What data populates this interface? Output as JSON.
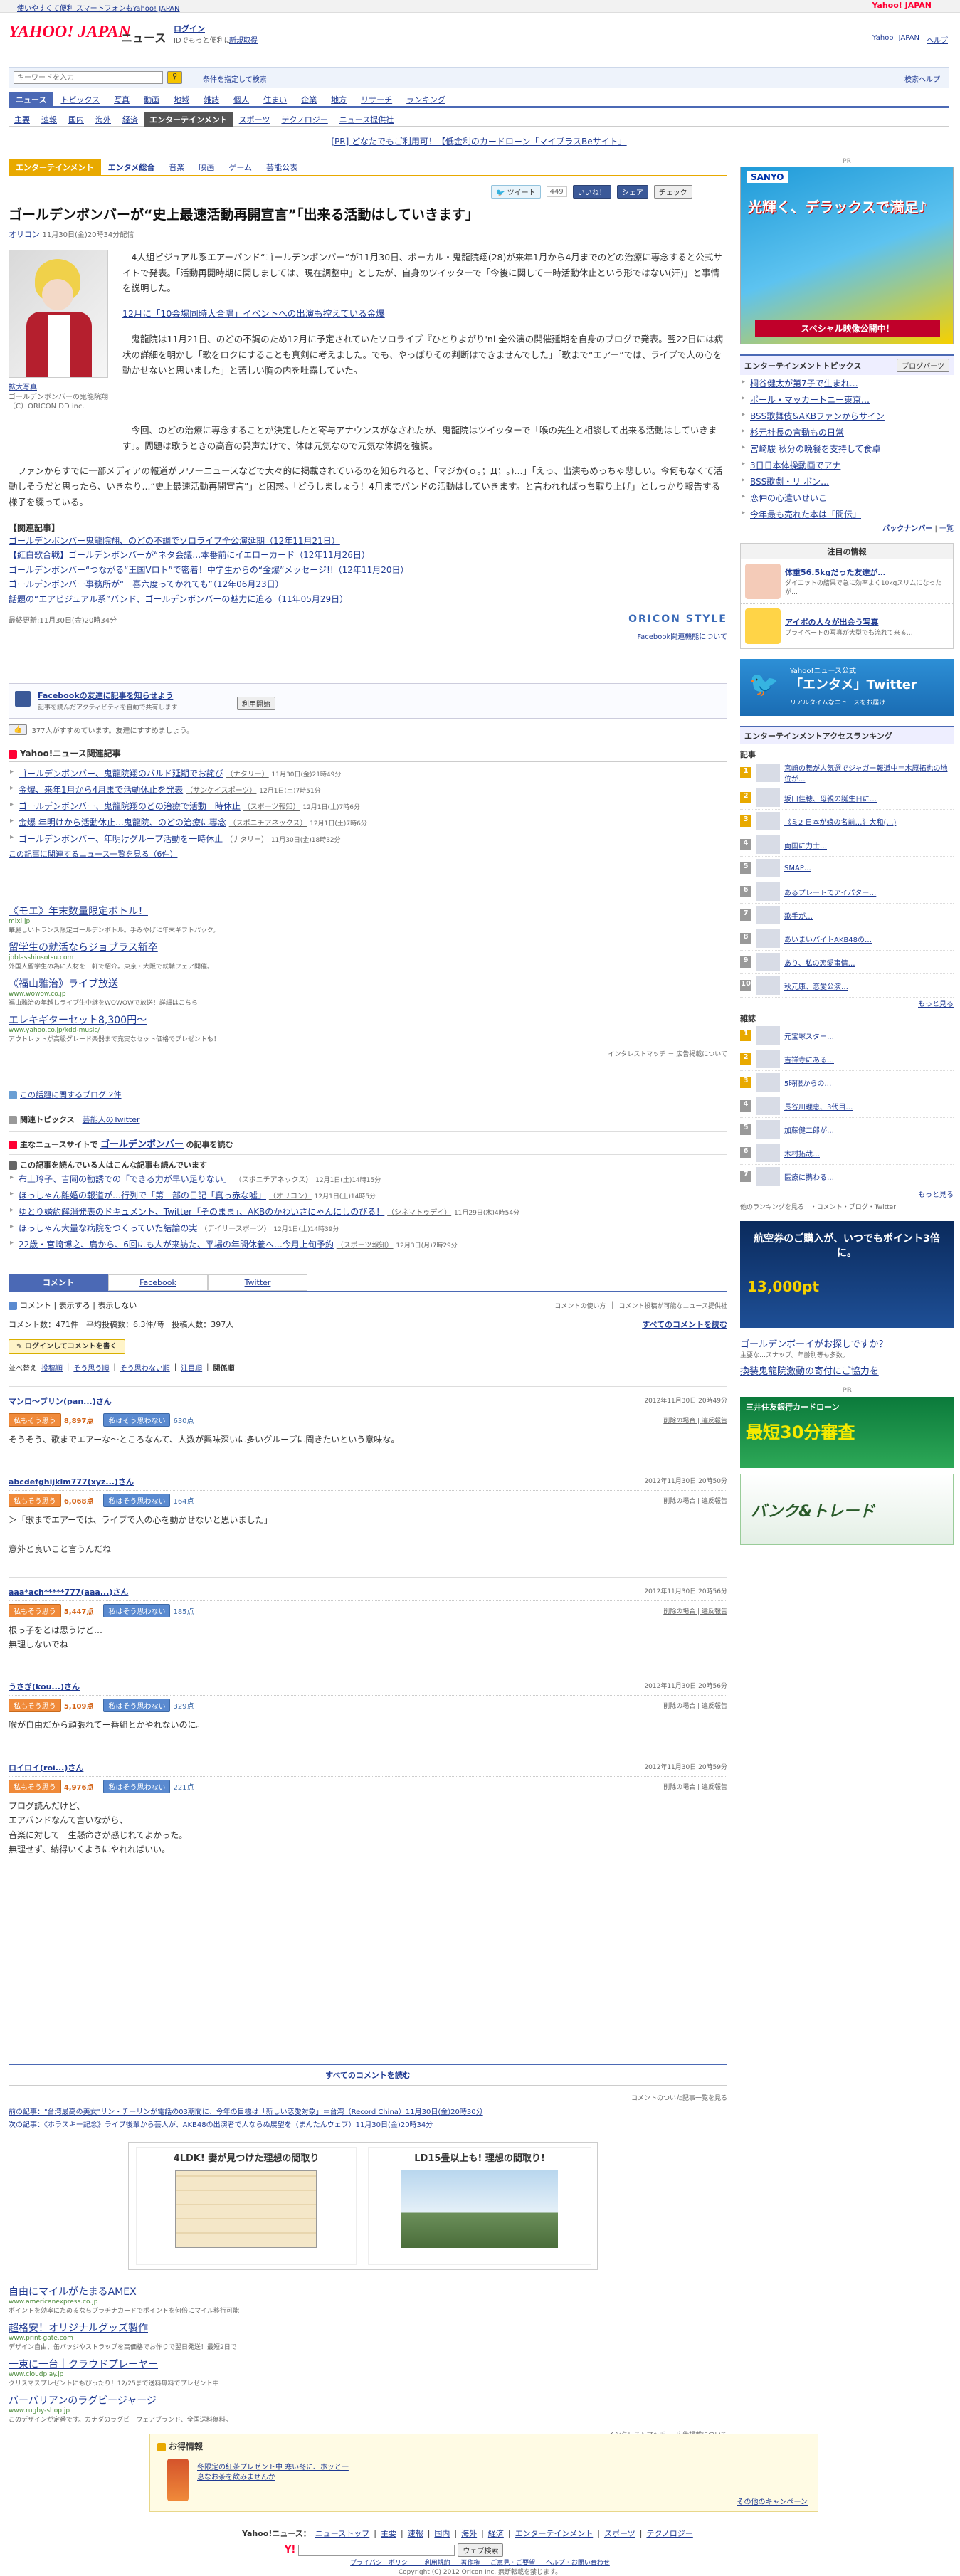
{
  "topbar": {
    "left_link": "使いやすくて便利 スマートフォンもYahoo! JAPAN",
    "right": "Yahoo! JAPAN"
  },
  "header": {
    "logo": "YAHOO! JAPAN",
    "section": "ニュース",
    "login": "ログイン",
    "login_sub": "IDでもっと便利に",
    "register": "新規取得",
    "right_links": [
      "Yahoo! JAPAN",
      "ヘルプ"
    ]
  },
  "search": {
    "placeholder": "キーワードを入力",
    "button": "検索",
    "right_link": "条件を指定して検索",
    "help": "検索ヘルプ"
  },
  "main_tabs": [
    "ニュース",
    "トピックス",
    "写真",
    "動画",
    "地域",
    "雑誌",
    "個人",
    "住まい",
    "企業",
    "地方",
    "リサーチ",
    "ランキング"
  ],
  "sub_nav": [
    "主要",
    "速報",
    "国内",
    "海外",
    "経済",
    "エンターテインメント",
    "スポーツ",
    "テクノロジー",
    "ニュース提供社"
  ],
  "pr_banner": "[PR] どなたでもご利用可！【低金利のカードローン「マイプラスBeサイト」",
  "cat_tabs": [
    "エンターテインメント",
    "エンタメ総合",
    "音楽",
    "映画",
    "ゲーム",
    "芸能公表"
  ],
  "social": {
    "tweet": "ツイート",
    "count": "449",
    "like": "いいね！",
    "share": "シェア",
    "check": "チェック"
  },
  "article": {
    "title": "ゴールデンボンバーが“史上最速活動再開宣言”「出来る活動はしていきます」",
    "source": "オリコン",
    "date": "11月30日(金)20時34分配信",
    "photo_link": "拡大写真",
    "photo_caption": "ゴールデンボンバーの鬼龍院翔（C）ORICON DD inc.",
    "p1": "4人組ビジュアル系エアーバンド“ゴールデンボンバー”が11月30日、ボーカル・鬼龍院翔(28)が来年1月から4月までのどの治療に専念すると公式サイトで発表。「活動再開時期に関しましては、現在調整中」としたが、自身のツイッターで「今後に関して一時活動休止という形ではない(汗)」と事情を説明した。",
    "highlight_link": "12月に「10会場同時大合唱」イベントへの出演も控えている金爆",
    "p2": "鬼龍院は11月21日、のどの不調のため12月に予定されていたソロライブ『ひとりよがり'nl 全公演の開催延期を自身のブログで発表。翌22日には病状の詳細を明かし「歌をロクにすることも真剣に考えました。でも、やっぱりその判断はできませんでした」「歌まで“エアー”では、ライブで人の心を動かせないと思いました」と苦しい胸の内を吐露していた。",
    "p3": "今回、のどの治療に専念することが決定したと寄与アナウンスがなされたが、鬼龍院はツイッターで「喉の先生と相談して出来る活動はしていきます」。問題は歌うときの高音の発声だけで、体は元気なので元気な体調を強調。",
    "p4": "ファンからすでに一部メディアの報道がフワーニュースなどで大々的に掲載されているのを知られると、「マジか(ｏ｡；Д；｡)...」「えっ、出演もめっちゃ悲しい。今何もなくて活動しそうだと思ったら、いきなり...“史上最速活動再開宣言”」と困惑。「どうしましょう！4月までバンドの活動はしていきます。と言われればっち取り上げ」としっかり報告する様子を綴っている。",
    "related_heading": "【関連記事】",
    "related": [
      "ゴールデンボンバー鬼龍院翔、のどの不調でソロライブ全公演延期（12年11月21日）",
      "【紅白歌合戦】ゴールデンボンバーが“ネタ会議…本番前にイエローカード（12年11月26日）",
      "ゴールデンボンバー“つながる“王国Vロト”で密着！中学生からの“金爆”メッセージ!!（12年11月20日）",
      "ゴールデンボンバー事務所が“一喜六度ってかれても”（12年06月23日）",
      "話題の“エアビジュアル系”バンド、ゴールデンボンバーの魅力に迫る（11年05月29日）"
    ],
    "updated": "最終更新:11月30日(金)20時34分",
    "brand": "ORICON STYLE",
    "fb_about": "Facebook関連機能について"
  },
  "fb_box": {
    "title": "Facebookの友達に記事を知らせよう",
    "sub": "記事を読んだアクティビティを自動で共有します",
    "btn": "利用開始",
    "like_line": "377人がすすめています。友達にすすめましょう。"
  },
  "yahoo_related": {
    "title": "Yahoo!ニュース関連記事",
    "items": [
      {
        "t": "ゴールデンボンバー、鬼龍院翔のバルド延期でお詫び",
        "s": "（ナタリー）",
        "d": "11月30日(金)21時49分"
      },
      {
        "t": "金爆、来年1月から4月まで活動休止を発表",
        "s": "（サンケイスポーツ）",
        "d": "12月1日(土)7時51分"
      },
      {
        "t": "ゴールデンボンバー、鬼龍院翔のどの治療で活動一時休止",
        "s": "（スポーツ報知）",
        "d": "12月1日(土)7時6分"
      },
      {
        "t": "金爆 年明けから活動休止…鬼龍院、のどの治療に専念",
        "s": "（スポニチアネックス）",
        "d": "12月1日(土)7時6分"
      },
      {
        "t": "ゴールデンボンバー、年明けグループ活動を一時休止",
        "s": "（ナタリー）",
        "d": "11月30日(金)18時32分"
      }
    ],
    "more": "この記事に関連するニュース一覧を見る（6件）"
  },
  "ads1": [
    {
      "t": "《モエ》年末数量限定ボトル！",
      "u": "mixi.jp",
      "d": "華麗しいトランス限定ゴールデンボトル。手みやげに年末ギフトパック。"
    },
    {
      "t": "留学生の就活ならジョブラス新卒",
      "u": "joblasshinsotsu.com",
      "d": "外国人留学生の為に人材を一軒で紹介。東京・大阪で就職フェア開催。"
    },
    {
      "t": "《福山雅治》ライブ放送",
      "u": "www.wowow.co.jp",
      "d": "福山雅治の年越しライブ生中継をWOWOWで放送！詳細はこちら"
    },
    {
      "t": "エレキギターセット8,300円〜",
      "u": "www.yahoo.co.jp/kdd-music/",
      "d": "アウトレットが高級グレード楽器まで充実なセット価格でプレゼントも！"
    }
  ],
  "ads1_footer": "インタレストマッチ － 広告掲載について",
  "blog_line": "この話題に関するブログ 2件",
  "kanren_topics": {
    "label": "関連トピックス",
    "link": "芸能人のTwitter"
  },
  "shusyu": {
    "label": "主なニュースサイトで",
    "link": "ゴールデンボンバー",
    "suffix": "の記事を読む"
  },
  "also_read": {
    "title": "この記事を読んでいる人はこんな記事も読んでいます",
    "items": [
      {
        "t": "布上玲子、吉岡の勧誘での「できる力が早い足りない」",
        "s": "（スポニチアネックス）",
        "d": "12月1日(土)14時15分"
      },
      {
        "t": "ほっしゃん離婚の報道が…行列で「第一部の日記「真っ赤な嘘」",
        "s": "（オリコン）",
        "d": "12月1日(土)14時5分"
      },
      {
        "t": "ゆとり婚約解消発表のドキュメント、Twitter「そのまま」、AKBのかわいさにゃんにしのびる！",
        "s": "（シネマトゥデイ）",
        "d": "11月29日(木)4時54分"
      },
      {
        "t": "ほっしゃん大量な病院をつくっていた結論の実",
        "s": "（デイリースポーツ）",
        "d": "12月1日(土)14時39分"
      },
      {
        "t": "22歳・宮崎博之、肩から、6回にも人が来訪た、平場の年間休養へ…今月上旬予約",
        "s": "（スポーツ報知）",
        "d": "12月3日(月)7時29分"
      }
    ]
  },
  "comment_tabs": [
    "コメント",
    "Facebook",
    "Twitter"
  ],
  "comments_hdr": {
    "title": "コメント | 表示する | 表示しない",
    "right1": "コメントの使い方",
    "right2": "コメント投稿が可能なニュース提供社"
  },
  "comments_stats": {
    "count": "コメント数：471件",
    "avg": "平均投稿数：6.3件/時",
    "posts": "投稿人数：397人",
    "all": "すべてのコメントを読む",
    "login_btn": "ログインしてコメントを書く"
  },
  "sort": {
    "label": "並べ替え",
    "opts": [
      "投稿順",
      "そう思う順",
      "そう思わない順",
      "注目順",
      "関係順"
    ]
  },
  "comments": [
    {
      "user": "マンロ〜ブリン(pan...)さん",
      "date": "2012年11月30日 20時49分",
      "agree": "8,897点",
      "disagree": "630点",
      "text": "そうそう、歌までエアーな～ところなんて、人数が興味深いに多いグループに聞きたいという意味な。"
    },
    {
      "user": "abcdefghijklm777(xyz...)さん",
      "date": "2012年11月30日 20時50分",
      "agree": "6,068点",
      "disagree": "164点",
      "text": "＞「歌までエアーでは、ライブで人の心を動かせないと思いました」\n\n意外と良いこと言うんだね"
    },
    {
      "user": "aaa*ach*****777(aaa...)さん",
      "date": "2012年11月30日 20時56分",
      "agree": "5,447点",
      "disagree": "185点",
      "text": "根っ子をとは思うけど…\n無理しないでね"
    },
    {
      "user": "うさぎ(kou...)さん",
      "date": "2012年11月30日 20時56分",
      "agree": "5,109点",
      "disagree": "329点",
      "text": "喉が自由だから頑張れてー番組とかやれないのに。"
    },
    {
      "user": "ロイロイ(roi...)さん",
      "date": "2012年11月30日 20時59分",
      "agree": "4,976点",
      "disagree": "221点",
      "text": "ブログ読んだけど、\nエアバンドなんて言いながら、\n音楽に対して一生懸命さが感じれてよかった。\n無理せず、納得いくようにやれればいい。"
    }
  ],
  "vote_yes": "私もそう思う",
  "vote_no": "私はそう思わない",
  "report": "削除の場合 | 違反報告",
  "all_comments": "すべてのコメントを読む",
  "comment_list_link": "コメントのついた記事一覧を見る",
  "prev_next": {
    "prev": "前の記事：\"台湾最高の美女\"リン・チーリンが電話の03期間に、今年の目標は「新しい恋愛対象」＝台湾（Record China）11月30日(金)20時30分",
    "next": "次の記事：《ホラスキー記念》ライブ後輩から芸人が、AKB48の出演者で人ならぬ展望を（まんたんウェブ）11月30日(金)20時34分"
  },
  "bottom_ads": {
    "a": "4LDK! 妻が見つけた理想の間取り",
    "b": "LD15畳以上も! 理想の間取り!"
  },
  "ads2": [
    {
      "t": "自由にマイルがたまるAMEX",
      "u": "www.americanexpress.co.jp",
      "d": "ポイントを効率にためるならプラチナカードでポイントを何倍にマイル移行可能"
    },
    {
      "t": "超格安！オリジナルグッズ製作",
      "u": "www.print-gate.com",
      "d": "デザイン自由、缶バッジやストラップを高価格でお作りで翌日発送！最短2日で"
    },
    {
      "t": "一束に一台｜クラウドプレーヤー",
      "u": "www.cloudplay.jp",
      "d": "クリスマスプレゼントにもぴったり！12/25まで送料無料でプレゼント中"
    },
    {
      "t": "バーバリアンのラグビージャージ",
      "u": "www.rugby-shop.jp",
      "d": "このデザインが定番です。カナダのラグビーウェアブランド、全国送料無料。"
    }
  ],
  "ads2_footer": "インタレストマッチ － 広告掲載について",
  "otoku": {
    "title": "お得情報",
    "text": "冬限定の紅茶プレゼント中 寒い冬に、ホッと一息なお茶を飲みませんか",
    "more": "その他のキャンペーン"
  },
  "footer_nav": {
    "label": "Yahoo!ニュース：",
    "links": [
      "ニューストップ",
      "主要",
      "速報",
      "国内",
      "海外",
      "経済",
      "エンターテインメント",
      "スポーツ",
      "テクノロジー"
    ]
  },
  "footer_search_btn": "ウェブ検索",
  "footer_links": "プライバシーポリシー － 利用規約 － 著作権 － ご意見・ご要望 － ヘルプ・お問い合わせ",
  "copyright1": "Copyright (C) 2012 Oricon Inc. 無断転載を禁じます。",
  "copyright2": "Copyright (C) 2012 Yahoo Japan Corporation. All Rights Reserved.",
  "side": {
    "pr": "PR",
    "banner1": "光輝く、デラックスで満足♪",
    "banner1_sub": "スペシャル映像公開中！",
    "ent_topics_title": "エンターテインメントトピックス",
    "ent_topics_btn": "ブログパーツ",
    "ent_topics": [
      "桐谷健太が第7子で生まれ…",
      "ポール・マッカートニー東京…",
      "BSS歌舞伎&AKBファンからサイン",
      "杉元社長の言動もの日常",
      "宮崎駿 秋分の晩餐を支持して食卓",
      "3日日本体操動画でアナ",
      "BSS歌劇・リ ボン…",
      "恋仲の心遣いせいこ",
      "今年最も売れた本は「間伝」"
    ],
    "backnumber": "バックナンバー",
    "list": "一覧",
    "attention": "注目の情報",
    "attn1": "体重56.5kgだった友達が…",
    "attn1_sub": "ダイエットの結果で急に効率よく10kgスリムになったが…",
    "attn2": "アイボの人々が出会う写真",
    "attn2_sub": "プライベートの写真が大型でも流れて来る…",
    "twitter_title": "Yahoo!ニュース公式",
    "twitter_big": "「エンタメ」Twitter",
    "twitter_sub": "リアルタイムなニュースをお届け",
    "ranking_title": "エンターテインメントアクセスランキング",
    "rank_label_news": "記事",
    "rank_news": [
      "宮崎の舞が人気選でジャガー報道中＝木原拓也の地位が...",
      "坂口佳穂、母親の誕生日に…",
      "《ミ2 日本が娘の名前…》大和(…)",
      "両国に力士…",
      "SMAP…",
      "あるプレートでアイパター…",
      "歌手が…",
      "あいまいバイトAKB48の…",
      "あり、私の恋愛事情…",
      "秋元康、恋愛公演…"
    ],
    "rank_label_mag": "雑誌",
    "rank_mag": [
      "元宝塚スター…",
      "吉祥寺にある…",
      "5時限からの…",
      "長谷川理恵、3代目…",
      "加藤健二郎が…",
      "木村拓哉…",
      "医療に携わる…"
    ],
    "more": "もっと見る",
    "ranking_links": "他のランキングを見る　・コメント・ブログ・Twitter",
    "banner2": "航空券のご購入が、いつでもポイント3倍に。",
    "banner2_sub": "13,000pt",
    "ad_text_title": "ゴールデンボーイがお探しですか？",
    "ad_text": "主要な…スナップ。年齢別等も多数。",
    "ad_text2": "換装鬼龍院激動の寄付にご協力を",
    "pr2": "PR",
    "banner3": "三井住友銀行カードローン",
    "banner3_sub": "最短30分審査",
    "banner4": "バンク&トレード"
  }
}
